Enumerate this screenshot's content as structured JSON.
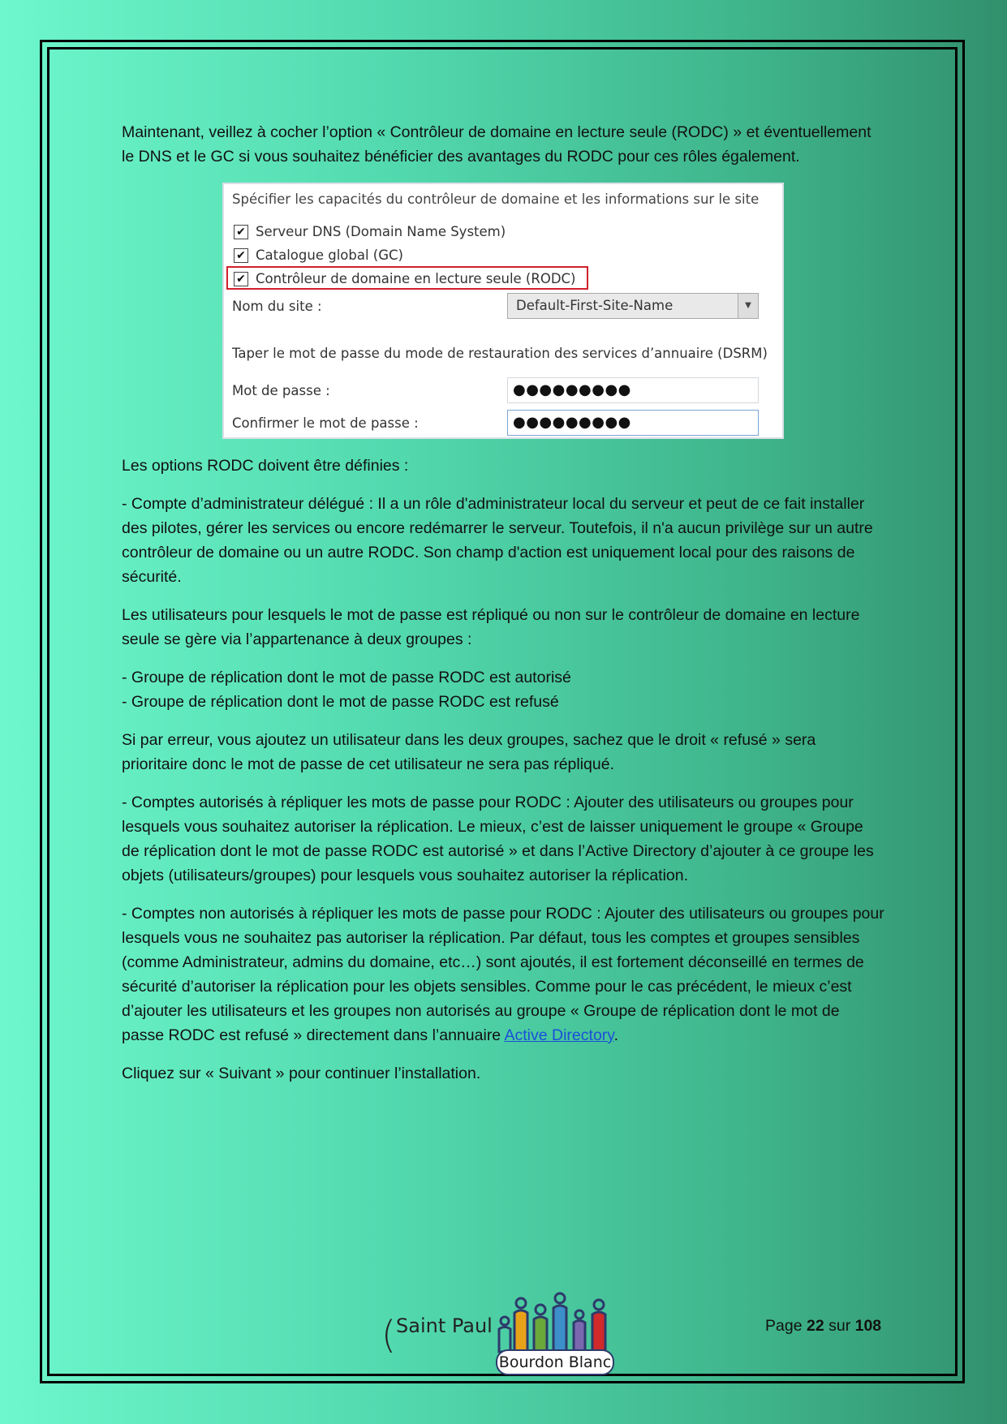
{
  "paragraphs": {
    "p1": "Maintenant, veillez à cocher l’option « Contrôleur de domaine en lecture seule (RODC) » et éventuellement le DNS et le GC si vous souhaitez bénéficier des avantages du RODC pour ces rôles également.",
    "p2": "Les options RODC doivent être définies :",
    "p3": "- Compte d’administrateur délégué : Il a un rôle d'administrateur local du serveur et peut de ce fait installer des pilotes, gérer les services ou encore redémarrer le serveur. Toutefois, il n'a aucun privilège sur un autre contrôleur de domaine ou un autre RODC. Son champ d'action est uniquement local pour des raisons de sécurité.",
    "p4": "Les utilisateurs pour lesquels le mot de passe est répliqué ou non sur le contrôleur de domaine en lecture seule se gère via l’appartenance à deux groupes :",
    "p5a": "- Groupe de réplication dont le mot de passe RODC est autorisé",
    "p5b": "- Groupe de réplication dont le mot de passe RODC est refusé",
    "p6": "Si par erreur, vous ajoutez un utilisateur dans les deux groupes, sachez que le droit « refusé » sera prioritaire donc le mot de passe de cet utilisateur ne sera pas répliqué.",
    "p7": "- Comptes autorisés à répliquer les mots de passe pour RODC : Ajouter des utilisateurs ou groupes pour lesquels vous souhaitez autoriser la réplication. Le mieux, c’est de laisser uniquement le groupe « Groupe de réplication dont le mot de passe RODC est autorisé » et dans l’Active Directory d’ajouter à ce groupe les objets (utilisateurs/groupes) pour lesquels vous souhaitez autoriser la réplication.",
    "p8_text": "- Comptes non autorisés à répliquer les mots de passe pour RODC : Ajouter des utilisateurs ou groupes pour lesquels vous ne souhaitez pas autoriser la réplication. Par défaut, tous les comptes et groupes sensibles (comme Administrateur, admins du domaine, etc…) sont ajoutés, il est fortement déconseillé en termes de sécurité d’autoriser la réplication pour les objets sensibles. Comme pour le cas précédent, le mieux c’est d’ajouter les utilisateurs et les groupes non autorisés au groupe « Groupe de réplication dont le mot de passe RODC est refusé » directement dans l’annuaire ",
    "p8_link": "Active Directory",
    "p8_end": ".",
    "p9": "Cliquez sur « Suivant » pour continuer l’installation."
  },
  "dialog": {
    "heading": "Spécifier les capacités du contrôleur de domaine et les informations sur le site",
    "checkboxes": [
      {
        "label": "Serveur DNS (Domain Name System)",
        "checked": true
      },
      {
        "label": "Catalogue global (GC)",
        "checked": true
      },
      {
        "label": "Contrôleur de domaine en lecture seule (RODC)",
        "checked": true
      }
    ],
    "check_glyph": "✔",
    "site_label": "Nom du site :",
    "site_value": "Default-First-Site-Name",
    "dsrm_heading": "Taper le mot de passe du mode de restauration des services d’annuaire (DSRM)",
    "password_label": "Mot de passe :",
    "password_value": "●●●●●●●●●",
    "confirm_label": "Confirmer le mot de passe :",
    "confirm_value": "●●●●●●●●●",
    "highlight_color": "#d2202d"
  },
  "footer": {
    "paren": "(",
    "school": "Saint Paul",
    "logo_text": "Bourdon Blanc",
    "page_prefix": "Page",
    "page_current": "22",
    "page_sep": "sur",
    "page_total": "108"
  }
}
